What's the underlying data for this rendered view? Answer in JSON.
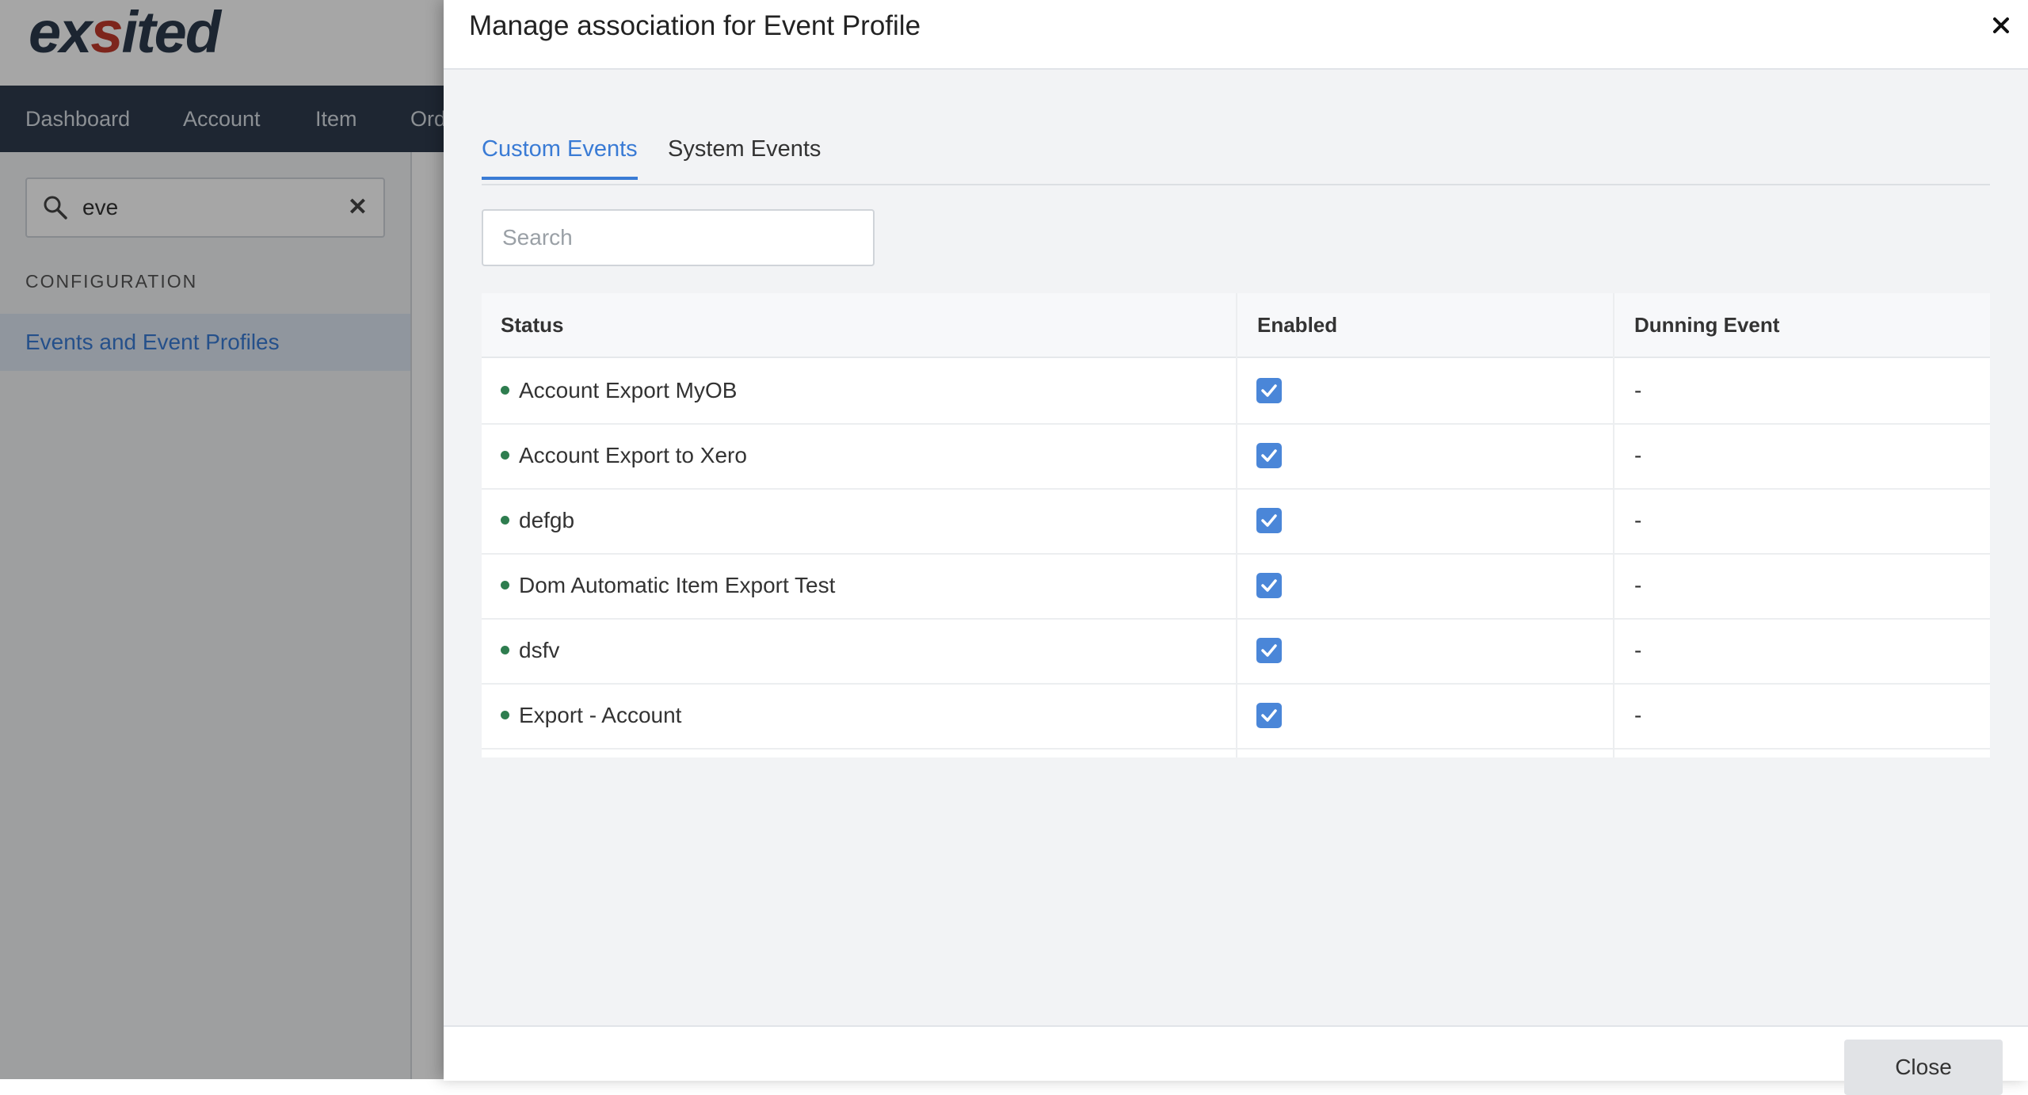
{
  "app": {
    "logo": {
      "part1": "ex",
      "accent": "s",
      "part2": "ited"
    },
    "nav": [
      "Dashboard",
      "Account",
      "Item",
      "Ord"
    ],
    "sidebar": {
      "search_value": "eve",
      "section_label": "CONFIGURATION",
      "active_link": "Events and Event Profiles"
    }
  },
  "modal": {
    "title": "Manage association for Event Profile",
    "tabs": [
      {
        "label": "Custom Events",
        "active": true
      },
      {
        "label": "System Events",
        "active": false
      }
    ],
    "search_placeholder": "Search",
    "table": {
      "columns": [
        "Status",
        "Enabled",
        "Dunning Event"
      ],
      "rows": [
        {
          "status": "Account Export MyOB",
          "enabled": true,
          "dunning": "-"
        },
        {
          "status": "Account Export to Xero",
          "enabled": true,
          "dunning": "-"
        },
        {
          "status": "defgb",
          "enabled": true,
          "dunning": "-"
        },
        {
          "status": "Dom Automatic Item Export Test",
          "enabled": true,
          "dunning": "-"
        },
        {
          "status": "dsfv",
          "enabled": true,
          "dunning": "-"
        },
        {
          "status": "Export - Account",
          "enabled": true,
          "dunning": "-"
        }
      ]
    },
    "footer": {
      "close_label": "Close"
    }
  },
  "colors": {
    "accent": "#3a7bd5",
    "navbar": "#2e3b4e",
    "checkbox": "#4a86d8",
    "status_dot": "#2e7d4f"
  }
}
